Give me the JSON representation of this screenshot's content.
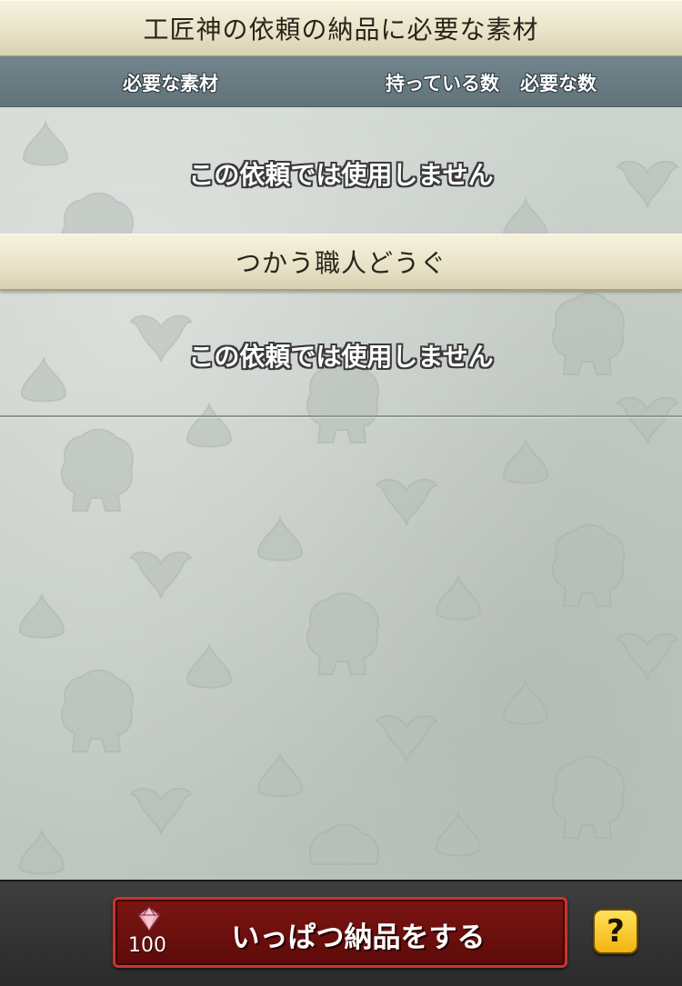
{
  "header": {
    "title": "工匠神の依頼の納品に必要な素材",
    "columns": {
      "material": "必要な素材",
      "owned": "持っている数",
      "required": "必要な数"
    }
  },
  "materials_section": {
    "empty_message": "この依頼では使用しません"
  },
  "tools_section": {
    "title": "つかう職人どうぐ",
    "empty_message": "この依頼では使用しません"
  },
  "footer": {
    "deliver_button_label": "いっぱつ納品をする",
    "gem_icon": "gem-icon",
    "gem_cost": "100",
    "help_label": "?"
  }
}
